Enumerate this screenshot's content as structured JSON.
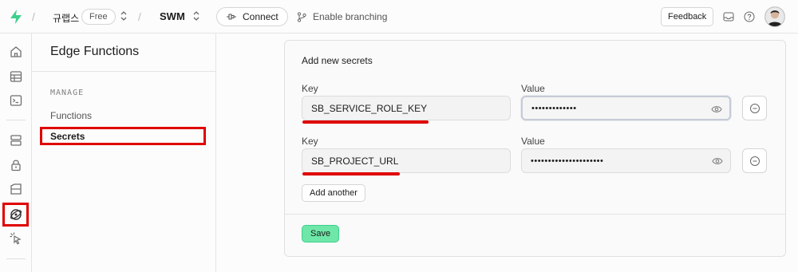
{
  "topbar": {
    "org_name": "규랩스",
    "plan_badge": "Free",
    "project_name": "SWM",
    "connect_label": "Connect",
    "branching_label": "Enable branching",
    "feedback_label": "Feedback"
  },
  "sidebar": {
    "title": "Edge Functions",
    "section_label": "MANAGE",
    "items": [
      {
        "label": "Functions"
      },
      {
        "label": "Secrets"
      }
    ]
  },
  "secrets_form": {
    "heading": "Add new secrets",
    "rows": [
      {
        "key_label": "Key",
        "key_value": "SB_SERVICE_ROLE_KEY",
        "value_label": "Value",
        "value_masked": "•••••••••••••"
      },
      {
        "key_label": "Key",
        "key_value": "SB_PROJECT_URL",
        "value_label": "Value",
        "value_masked": "•••••••••••••••••••••"
      }
    ],
    "add_another_label": "Add another",
    "save_label": "Save"
  },
  "colors": {
    "brand_green": "#3ecf8e",
    "save_bg": "#6ee7a8",
    "annotation_red": "#e00000"
  }
}
